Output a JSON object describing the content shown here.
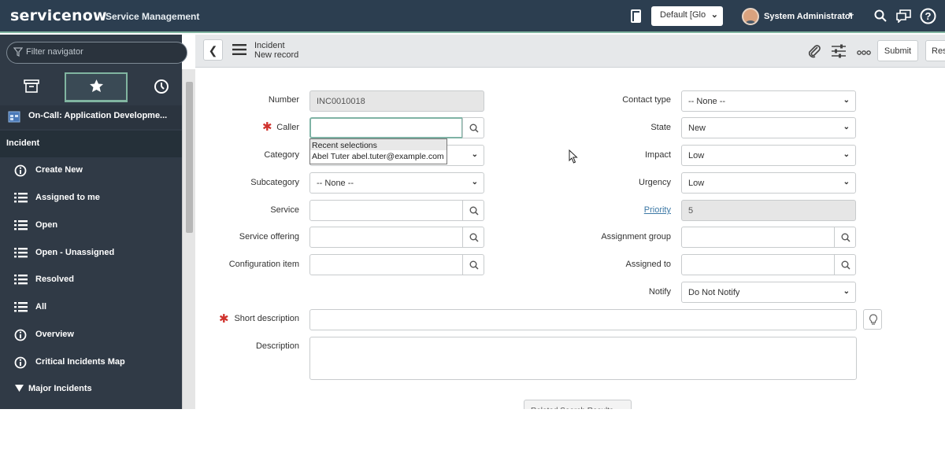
{
  "header": {
    "logo": "servicenow",
    "app_name": "Service Management",
    "domain_select": "Default [Glo",
    "user_name": "System Administrator"
  },
  "sidebar": {
    "filter_placeholder": "Filter navigator",
    "favorite_item": "On-Call: Application Developme...",
    "section": "Incident",
    "items": [
      {
        "label": "Create New",
        "icon": "info-icon"
      },
      {
        "label": "Assigned to me",
        "icon": "list-icon"
      },
      {
        "label": "Open",
        "icon": "list-icon"
      },
      {
        "label": "Open - Unassigned",
        "icon": "list-icon"
      },
      {
        "label": "Resolved",
        "icon": "list-icon"
      },
      {
        "label": "All",
        "icon": "list-icon"
      },
      {
        "label": "Overview",
        "icon": "info-icon"
      },
      {
        "label": "Critical Incidents Map",
        "icon": "info-icon"
      },
      {
        "label": "Major Incidents",
        "icon": "triangle-down-icon"
      }
    ]
  },
  "form_header": {
    "table": "Incident",
    "record": "New record",
    "submit_label": "Submit",
    "resolve_label": "Reso"
  },
  "form": {
    "labels": {
      "number": "Number",
      "caller": "Caller",
      "category": "Category",
      "subcategory": "Subcategory",
      "service": "Service",
      "service_offering": "Service offering",
      "configuration_item": "Configuration item",
      "contact_type": "Contact type",
      "state": "State",
      "impact": "Impact",
      "urgency": "Urgency",
      "priority": "Priority",
      "assignment_group": "Assignment group",
      "assigned_to": "Assigned to",
      "notify": "Notify",
      "short_description": "Short description",
      "description": "Description"
    },
    "values": {
      "number": "INC0010018",
      "caller": "",
      "category": "",
      "subcategory": "-- None --",
      "service": "",
      "service_offering": "",
      "configuration_item": "",
      "contact_type": "-- None --",
      "state": "New",
      "impact": "Low",
      "urgency": "Low",
      "priority": "5",
      "assignment_group": "",
      "assigned_to": "",
      "notify": "Do Not Notify",
      "short_description": "",
      "description": ""
    },
    "caller_dropdown": {
      "header": "Recent selections",
      "item": "Abel Tuter  abel.tuter@example.com"
    },
    "related_search_label": "Related Search Results"
  },
  "colors": {
    "topbar": "#2c3e50",
    "sidebar": "#303a46",
    "accent": "#81b5a1",
    "required": "#d0322d",
    "link": "#3c78a5"
  }
}
